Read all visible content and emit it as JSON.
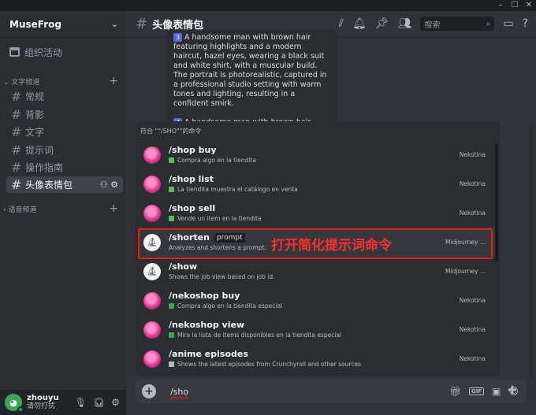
{
  "window": {
    "minimize": "–",
    "maximize": "☐",
    "close": "✕"
  },
  "server": {
    "name": "MuseFrog"
  },
  "sidebar": {
    "events_label": "组织活动",
    "text_category": "文字频道",
    "voice_category": "语音频道",
    "channels": [
      {
        "label": "常规"
      },
      {
        "label": "背影"
      },
      {
        "label": "文字"
      },
      {
        "label": "提示词"
      },
      {
        "label": "操作指南"
      },
      {
        "label": "头像表情包"
      }
    ]
  },
  "user": {
    "name": "zhouyu",
    "status": "请勿打扰"
  },
  "header": {
    "channel_title": "头像表情包",
    "search_placeholder": "搜索"
  },
  "message": {
    "item3_num": "3",
    "item3_text": "A handsome man with brown hair featuring highlights and a modern haircut, hazel eyes, wearing a black suit and white shirt, with a muscular build. The portrait is photorealistic, captured in a professional studio setting with warm tones and lighting, resulting in a confident smirk.",
    "item4_num": "4",
    "item4_text": "A handsome man with brown hair featuring highlights and a modern haircut, hazel eyes, wearing a black suit and white shirt"
  },
  "autocomplete": {
    "header": "符合 \"\"/SHO\"\"的命令",
    "commands": [
      {
        "name": "/shop buy",
        "option": "",
        "desc": "Compra algo en la tiendita",
        "bot": "Nekotina",
        "icon": "nekotina-avatar"
      },
      {
        "name": "/shop list",
        "option": "",
        "desc": "La tiendita muestra el catálogo en venta",
        "bot": "Nekotina",
        "icon": "nekotina-avatar"
      },
      {
        "name": "/shop sell",
        "option": "",
        "desc": "Vende un item en la tiendita",
        "bot": "Nekotina",
        "icon": "nekotina-avatar"
      },
      {
        "name": "/shorten",
        "option": "prompt",
        "desc": "Analyzes and shortens a prompt.",
        "bot": "Midjourney ...",
        "icon": "midjourney-avatar"
      },
      {
        "name": "/show",
        "option": "",
        "desc": "Shows the job view based on job id.",
        "bot": "Midjourney ...",
        "icon": "midjourney-avatar"
      },
      {
        "name": "/nekoshop buy",
        "option": "",
        "desc": "Compra algo en la tiendita especial",
        "bot": "Nekotina",
        "icon": "nekotina-avatar"
      },
      {
        "name": "/nekoshop view",
        "option": "",
        "desc": "Mira la lista de items disponibles en la tiendita especial",
        "bot": "Nekotina",
        "icon": "nekotina-avatar"
      },
      {
        "name": "/anime episodes",
        "option": "",
        "desc": "Shows the latest episodes from Crunchyroll and other sources",
        "bot": "Nekotina",
        "icon": "nekotina-avatar"
      }
    ]
  },
  "annotation": {
    "text": "打开简化提示词命令",
    "color": "#ff2e2e"
  },
  "input": {
    "value": "/sho"
  },
  "colors": {
    "accent": "#5865f2",
    "highlight": "#e0201d"
  }
}
